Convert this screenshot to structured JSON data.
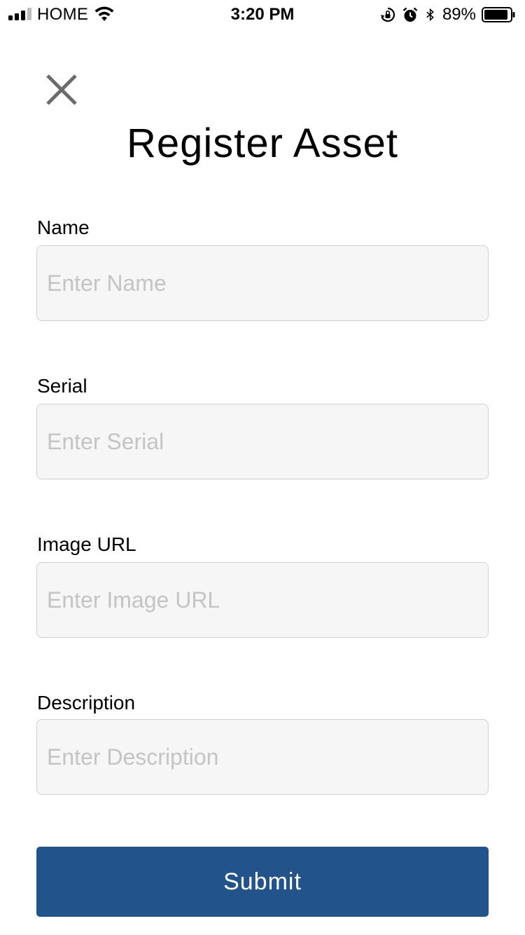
{
  "status_bar": {
    "carrier": "HOME",
    "time": "3:20 PM",
    "battery_percent": "89%",
    "icons": [
      "signal-icon",
      "wifi-icon",
      "orientation-lock-icon",
      "alarm-icon",
      "bluetooth-icon",
      "battery-icon"
    ]
  },
  "header": {
    "close_icon": "close-icon",
    "title": "Register Asset"
  },
  "form": {
    "fields": [
      {
        "label": "Name",
        "placeholder": "Enter Name",
        "value": ""
      },
      {
        "label": "Serial",
        "placeholder": "Enter Serial",
        "value": ""
      },
      {
        "label": "Image URL",
        "placeholder": "Enter Image URL",
        "value": ""
      },
      {
        "label": "Description",
        "placeholder": "Enter Description",
        "value": ""
      }
    ],
    "submit_label": "Submit"
  },
  "colors": {
    "accent": "#23538b",
    "input_background": "#f6f6f6",
    "input_border": "#d0d0d0",
    "placeholder": "#c4c4c4"
  }
}
